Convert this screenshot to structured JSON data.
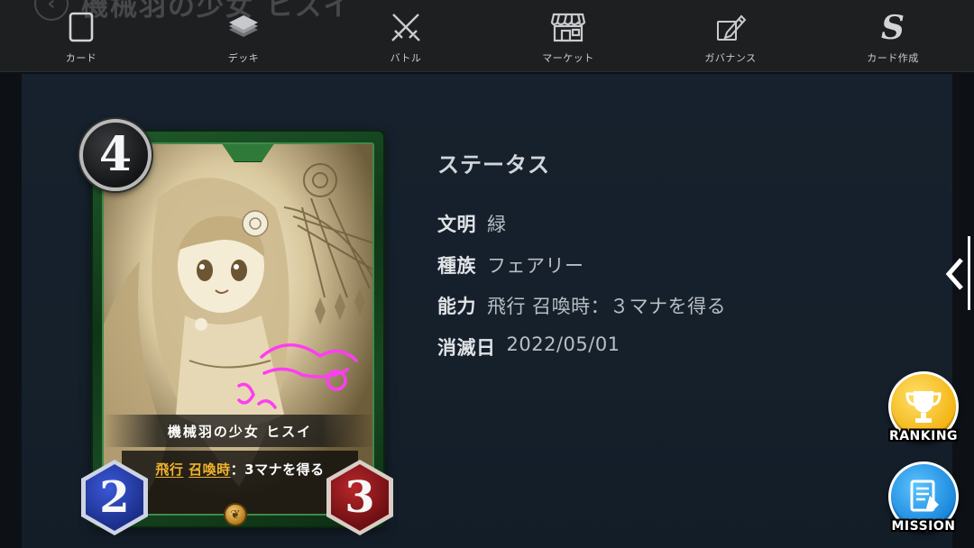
{
  "header": {
    "ghost_title": "機械羽の少女 ヒスイ",
    "nav": [
      {
        "label": "カード",
        "icon": "card-icon"
      },
      {
        "label": "デッキ",
        "icon": "deck-icon"
      },
      {
        "label": "バトル",
        "icon": "battle-swords-icon"
      },
      {
        "label": "マーケット",
        "icon": "market-store-icon"
      },
      {
        "label": "ガバナンス",
        "icon": "governance-pen-icon"
      },
      {
        "label": "カード作成",
        "icon": "card-create-s-icon"
      }
    ]
  },
  "card": {
    "cost": "4",
    "name": "機械羽の少女 ヒスイ",
    "ability_kw1": "飛行",
    "ability_kw2": "召喚時",
    "ability_rest": "：3マナを得る",
    "power": "2",
    "toughness": "3",
    "frame_color": "#1f5a2a"
  },
  "status": {
    "title": "ステータス",
    "rows": [
      {
        "key": "文明",
        "value": "緑"
      },
      {
        "key": "種族",
        "value": "フェアリー"
      },
      {
        "key": "能力",
        "value": "飛行 召喚時：３マナを得る"
      },
      {
        "key": "消滅日",
        "value": "2022/05/01"
      }
    ]
  },
  "fabs": {
    "ranking_label": "RANKING",
    "mission_label": "MISSION"
  },
  "colors": {
    "accent_gold": "#f0b12c",
    "ranking": "#f6c21c",
    "mission": "#1e9be8",
    "panel": "#16212d"
  }
}
